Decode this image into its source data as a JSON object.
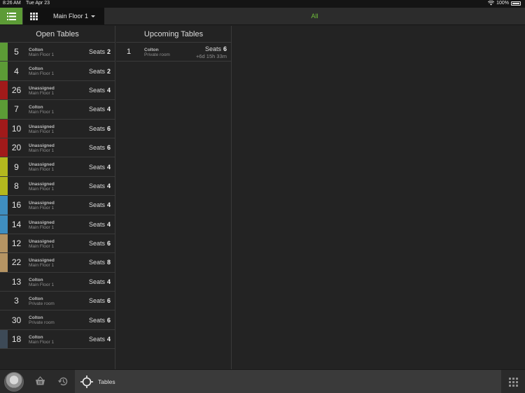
{
  "status": {
    "time": "8:26 AM",
    "date": "Tue Apr 23",
    "battery": "100%"
  },
  "topbar": {
    "floor": "Main Floor 1",
    "filter": "All"
  },
  "open": {
    "title": "Open Tables",
    "rows": [
      {
        "num": "5",
        "server": "Colton",
        "area": "Main Floor 1",
        "seats_label": "Seats",
        "seats": "2",
        "color": "#5c9b36"
      },
      {
        "num": "4",
        "server": "Colton",
        "area": "Main Floor 1",
        "seats_label": "Seats",
        "seats": "2",
        "color": "#5c9b36"
      },
      {
        "num": "26",
        "server": "Unassigned",
        "area": "Main Floor 1",
        "seats_label": "Seats",
        "seats": "4",
        "color": "#a11a1a"
      },
      {
        "num": "7",
        "server": "Colton",
        "area": "Main Floor 1",
        "seats_label": "Seats",
        "seats": "4",
        "color": "#5c9b36"
      },
      {
        "num": "10",
        "server": "Unassigned",
        "area": "Main Floor 1",
        "seats_label": "Seats",
        "seats": "6",
        "color": "#a11a1a"
      },
      {
        "num": "20",
        "server": "Unassigned",
        "area": "Main Floor 1",
        "seats_label": "Seats",
        "seats": "6",
        "color": "#a11a1a"
      },
      {
        "num": "9",
        "server": "Unassigned",
        "area": "Main Floor 1",
        "seats_label": "Seats",
        "seats": "4",
        "color": "#b4b81e"
      },
      {
        "num": "8",
        "server": "Unassigned",
        "area": "Main Floor 1",
        "seats_label": "Seats",
        "seats": "4",
        "color": "#b4b81e"
      },
      {
        "num": "16",
        "server": "Unassigned",
        "area": "Main Floor 1",
        "seats_label": "Seats",
        "seats": "4",
        "color": "#3f8ec0"
      },
      {
        "num": "14",
        "server": "Unassigned",
        "area": "Main Floor 1",
        "seats_label": "Seats",
        "seats": "4",
        "color": "#3f8ec0"
      },
      {
        "num": "12",
        "server": "Unassigned",
        "area": "Main Floor 1",
        "seats_label": "Seats",
        "seats": "6",
        "color": "#b59463"
      },
      {
        "num": "22",
        "server": "Unassigned",
        "area": "Main Floor 1",
        "seats_label": "Seats",
        "seats": "8",
        "color": "#b59463"
      },
      {
        "num": "13",
        "server": "Colton",
        "area": "Main Floor 1",
        "seats_label": "Seats",
        "seats": "4",
        "color": ""
      },
      {
        "num": "3",
        "server": "Colton",
        "area": "Private room",
        "seats_label": "Seats",
        "seats": "6",
        "color": ""
      },
      {
        "num": "30",
        "server": "Colton",
        "area": "Private room",
        "seats_label": "Seats",
        "seats": "6",
        "color": ""
      },
      {
        "num": "18",
        "server": "Colton",
        "area": "Main Floor 1",
        "seats_label": "Seats",
        "seats": "4",
        "color": "#3d4a57"
      }
    ]
  },
  "upcoming": {
    "title": "Upcoming Tables",
    "rows": [
      {
        "num": "1",
        "server": "Colton",
        "area": "Private room",
        "seats_label": "Seats",
        "seats": "6",
        "eta": "+6d  15h  33m"
      }
    ]
  },
  "bottom": {
    "tables_label": "Tables"
  },
  "icons": {
    "list_view": "list-icon",
    "grid_view": "grid-icon",
    "basket": "basket-icon",
    "history": "history-icon",
    "locate": "crosshair-icon",
    "keypad": "keypad-icon"
  }
}
